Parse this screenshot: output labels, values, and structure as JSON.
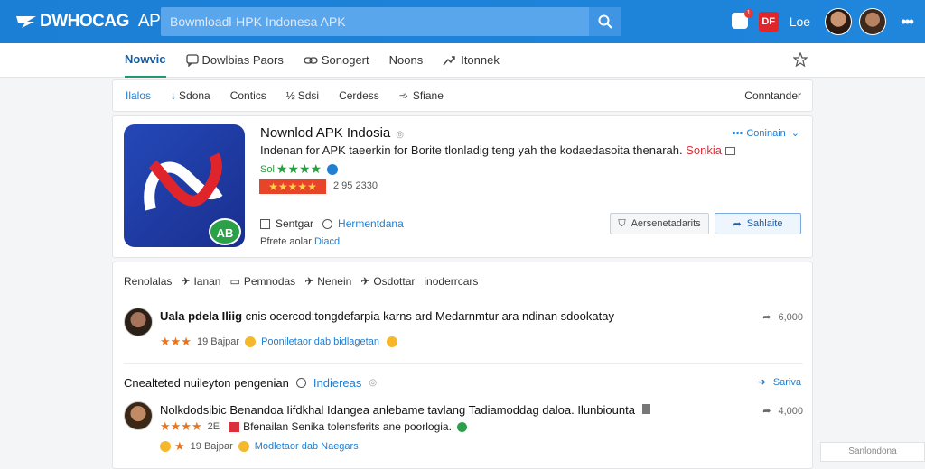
{
  "header": {
    "logo_text": "DWHOCAG",
    "logo_suffix": "APK",
    "search_placeholder": "Bowmloadl-HPK Indonesa APK",
    "notif_count": "1",
    "badge": "DF",
    "label": "Loe"
  },
  "subnav": {
    "items": [
      "Nowvic",
      "Dowlbias",
      "Paors",
      "Sonogert",
      "Noons",
      "Itonnek"
    ]
  },
  "filters": {
    "items": [
      "Ilalos",
      "Sdona",
      "Contics",
      "Sdsi",
      "Cerdess",
      "Sfiane"
    ],
    "right": "Conntander"
  },
  "app": {
    "title": "Nownlod APK Indosia",
    "description": "Indenan for APK taeerkin for Borite tlonladig teng yah the kodaedasoita thenarah.",
    "description_tag": "Sonkia",
    "rating_label": "Sol",
    "downloads": "2 95 2330",
    "compare": "Coninain",
    "action1": "Sentgar",
    "action2": "Hermentdana",
    "sub_prefix": "Pfrete aolar",
    "sub_link": "Diacd",
    "btn_outline": "Aersenetadarits",
    "btn_blue": "Sahlaite",
    "icon_badge": "AB"
  },
  "feed": {
    "tabs": [
      "Renolalas",
      "Ianan",
      "Pemnodas",
      "Nenein",
      "Osdottar",
      "inoderrcars"
    ],
    "post1": {
      "author": "Uala pdela Iliig",
      "text": "cnis ocercod:tongdefarpia karns ard Medarnmtur ara ndinan sdookatay",
      "rating_text": "19 Bajpar",
      "link": "Pooniletaor dab bidlagetan",
      "share": "6,000"
    },
    "section_title": "Cnealteted nuileyton pengenian",
    "section_link": "Indiereas",
    "section_share": "Sariva",
    "post2": {
      "author": "Nolkdodsibic",
      "text": "Benandoa Iifdkhal Idangea anlebame tavlang Tadiamoddag daloa. Ilunbiounta",
      "line2_rating": "2E",
      "line2_text": "Bfenailan Senika tolensferits ane poorlogia.",
      "rating_text": "19 Bajpar",
      "link": "Modletaor dab Naegars",
      "share": "4,000"
    }
  },
  "footer": {
    "label": "Sanlondona"
  }
}
